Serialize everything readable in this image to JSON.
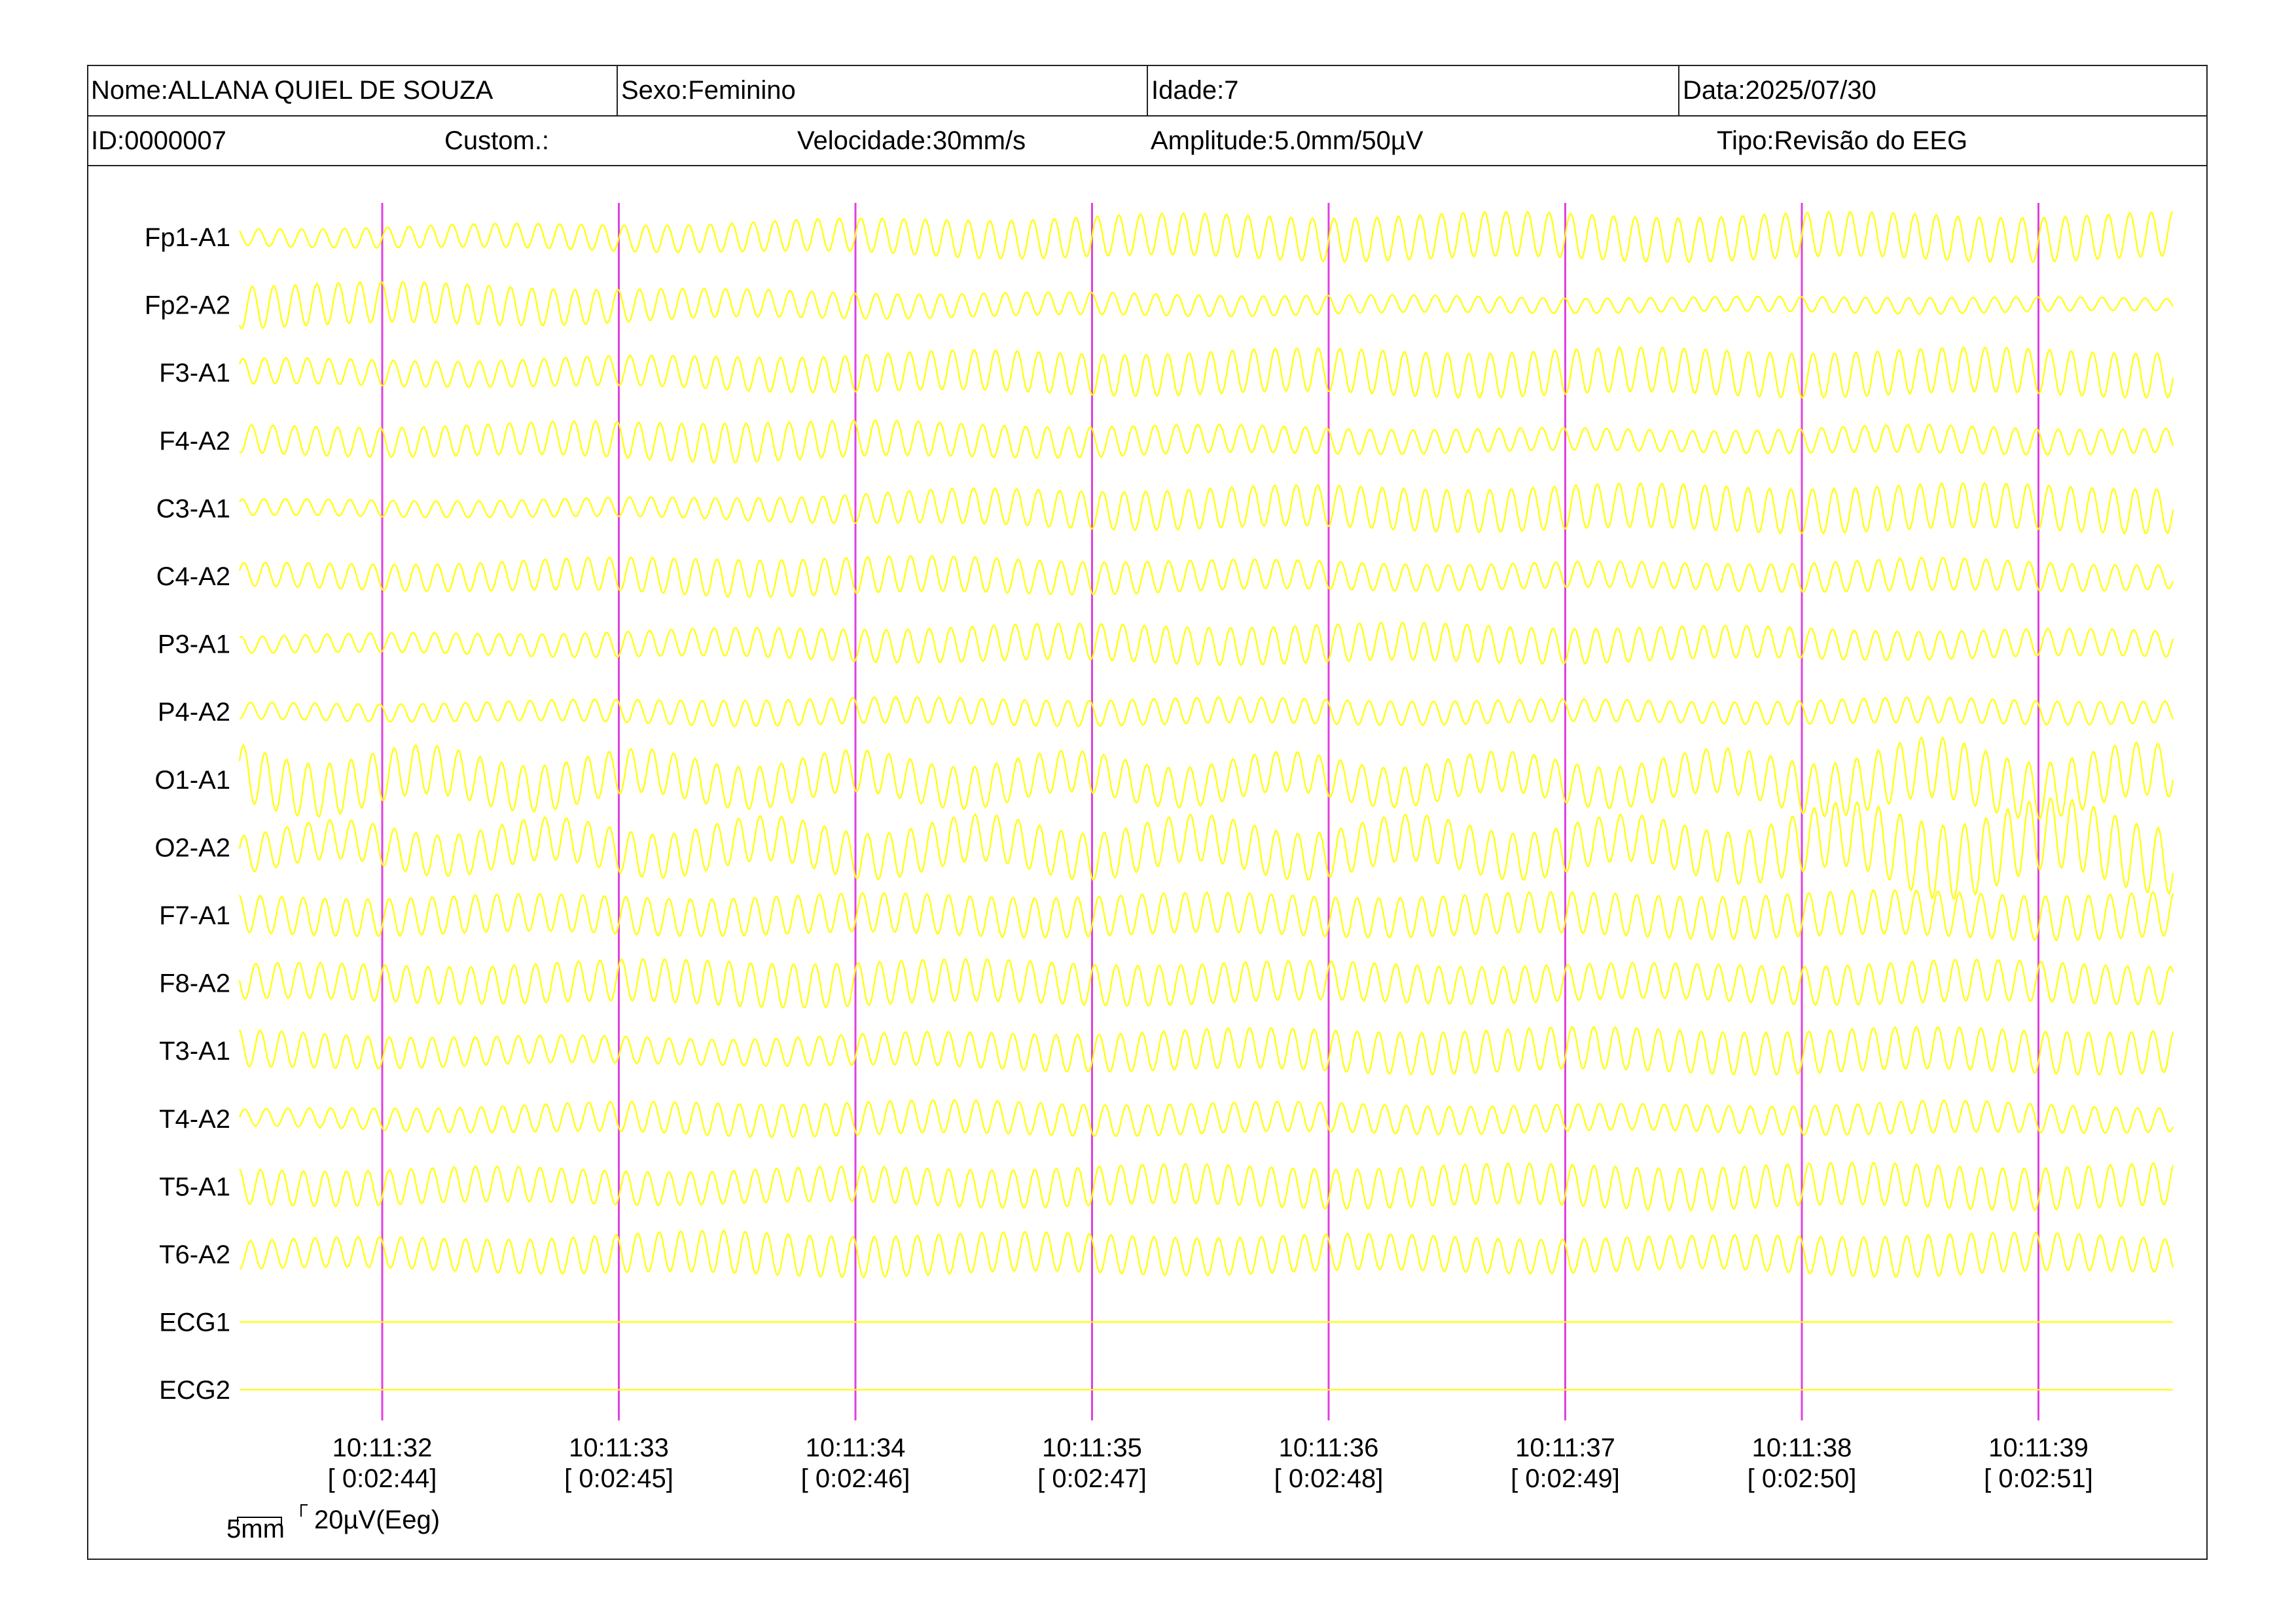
{
  "header": {
    "nome": "Nome:ALLANA QUIEL DE SOUZA",
    "sexo": "Sexo:Feminino",
    "idade": "Idade:7",
    "data": "Data:2025/07/30",
    "id": "ID:0000007",
    "custom": "Custom.:",
    "velocidade": "Velocidade:30mm/s",
    "amplitude": "Amplitude:5.0mm/50µV",
    "tipo": "Tipo:Revisão do EEG"
  },
  "colors": {
    "trace": "#ffff00",
    "marker": "#e040e0",
    "background": "#ffffff",
    "text": "#000000"
  },
  "chart_data": {
    "type": "line",
    "title": "",
    "x_unit": "time",
    "x_range": [
      "10:11:31.4",
      "10:11:39.56"
    ],
    "channels": [
      "Fp1-A1",
      "Fp2-A2",
      "F3-A1",
      "F4-A2",
      "C3-A1",
      "C4-A2",
      "P3-A1",
      "P4-A2",
      "O1-A1",
      "O2-A2",
      "F7-A1",
      "F8-A2",
      "T3-A1",
      "T4-A2",
      "T5-A1",
      "T6-A2",
      "ECG1",
      "ECG2"
    ],
    "time_markers": [
      {
        "clock": "10:11:32",
        "elapsed": "[ 0:02:44]"
      },
      {
        "clock": "10:11:33",
        "elapsed": "[ 0:02:45]"
      },
      {
        "clock": "10:11:34",
        "elapsed": "[ 0:02:46]"
      },
      {
        "clock": "10:11:35",
        "elapsed": "[ 0:02:47]"
      },
      {
        "clock": "10:11:36",
        "elapsed": "[ 0:02:48]"
      },
      {
        "clock": "10:11:37",
        "elapsed": "[ 0:02:49]"
      },
      {
        "clock": "10:11:38",
        "elapsed": "[ 0:02:50]"
      },
      {
        "clock": "10:11:39",
        "elapsed": "[ 0:02:51]"
      }
    ],
    "scale_bar": {
      "time_label": "5mm",
      "amplitude_label": "20µV(Eeg)"
    },
    "waveform_frequency_hz": 11,
    "series_amplitude_profiles": [
      {
        "name": "Fp1-A1",
        "amp": [
          0.35,
          0.5,
          0.6,
          0.8,
          0.9,
          0.95,
          0.95,
          0.95,
          0.95
        ]
      },
      {
        "name": "Fp2-A2",
        "amp": [
          0.9,
          0.85,
          0.6,
          0.5,
          0.45,
          0.35,
          0.3,
          0.35,
          0.25
        ]
      },
      {
        "name": "F3-A1",
        "amp": [
          0.55,
          0.55,
          0.7,
          0.85,
          0.9,
          0.95,
          0.95,
          0.95,
          0.95
        ]
      },
      {
        "name": "F4-A2",
        "amp": [
          0.6,
          0.65,
          0.85,
          0.7,
          0.6,
          0.5,
          0.45,
          0.6,
          0.5
        ]
      },
      {
        "name": "C3-A1",
        "amp": [
          0.35,
          0.35,
          0.45,
          0.75,
          0.85,
          0.9,
          0.95,
          0.95,
          0.95
        ]
      },
      {
        "name": "C4-A2",
        "amp": [
          0.5,
          0.6,
          0.8,
          0.75,
          0.65,
          0.55,
          0.55,
          0.7,
          0.5
        ]
      },
      {
        "name": "P3-A1",
        "amp": [
          0.35,
          0.45,
          0.6,
          0.75,
          0.8,
          0.8,
          0.7,
          0.6,
          0.55
        ]
      },
      {
        "name": "P4-A2",
        "amp": [
          0.35,
          0.4,
          0.55,
          0.55,
          0.55,
          0.5,
          0.45,
          0.55,
          0.45
        ]
      },
      {
        "name": "O1-A1",
        "amp": [
          1.2,
          1.0,
          0.9,
          0.9,
          0.85,
          0.85,
          0.9,
          1.3,
          1.1
        ]
      },
      {
        "name": "O2-A2",
        "amp": [
          0.8,
          0.9,
          0.95,
          1.0,
          1.0,
          1.0,
          1.0,
          1.6,
          1.4
        ]
      },
      {
        "name": "F7-A1",
        "amp": [
          0.8,
          0.8,
          0.8,
          0.85,
          0.85,
          0.85,
          0.9,
          0.95,
          0.95
        ]
      },
      {
        "name": "F8-A2",
        "amp": [
          0.75,
          0.8,
          0.95,
          0.9,
          0.85,
          0.8,
          0.75,
          0.9,
          0.8
        ]
      },
      {
        "name": "T3-A1",
        "amp": [
          0.8,
          0.6,
          0.55,
          0.75,
          0.85,
          0.9,
          0.9,
          0.9,
          0.9
        ]
      },
      {
        "name": "T4-A2",
        "amp": [
          0.35,
          0.55,
          0.7,
          0.7,
          0.65,
          0.6,
          0.55,
          0.7,
          0.5
        ]
      },
      {
        "name": "T5-A1",
        "amp": [
          0.75,
          0.75,
          0.7,
          0.8,
          0.85,
          0.85,
          0.9,
          0.9,
          0.9
        ]
      },
      {
        "name": "T6-A2",
        "amp": [
          0.6,
          0.7,
          0.9,
          0.85,
          0.8,
          0.75,
          0.7,
          0.9,
          0.7
        ]
      },
      {
        "name": "ECG1",
        "amp": [
          0,
          0,
          0,
          0,
          0,
          0,
          0,
          0,
          0
        ]
      },
      {
        "name": "ECG2",
        "amp": [
          0,
          0,
          0,
          0,
          0,
          0,
          0,
          0,
          0
        ]
      }
    ]
  }
}
